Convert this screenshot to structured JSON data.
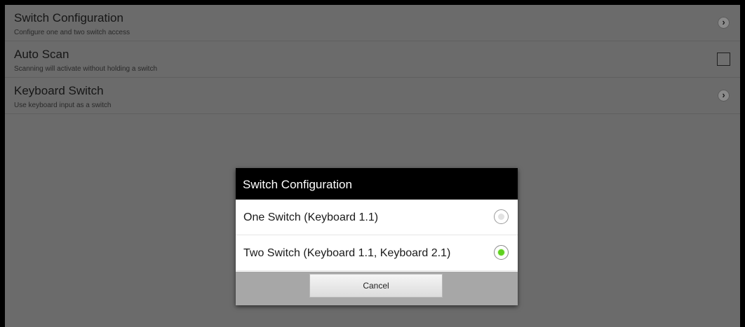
{
  "settings": {
    "items": [
      {
        "title": "Switch Configuration",
        "summary": "Configure one and two switch access",
        "widget": "chevron-icon"
      },
      {
        "title": "Auto Scan",
        "summary": "Scanning will activate without holding a switch",
        "widget": "checkbox",
        "checked": false
      },
      {
        "title": "Keyboard Switch",
        "summary": "Use keyboard input as a switch",
        "widget": "chevron-icon"
      }
    ]
  },
  "dialog": {
    "title": "Switch Configuration",
    "options": [
      {
        "label": "One Switch (Keyboard 1.1)",
        "selected": false
      },
      {
        "label": "Two Switch (Keyboard 1.1, Keyboard 2.1)",
        "selected": true
      }
    ],
    "cancel_label": "Cancel"
  },
  "colors": {
    "dim_background": "#6b6b6b",
    "dialog_header": "#000000",
    "radio_selected": "#5fd11f"
  }
}
